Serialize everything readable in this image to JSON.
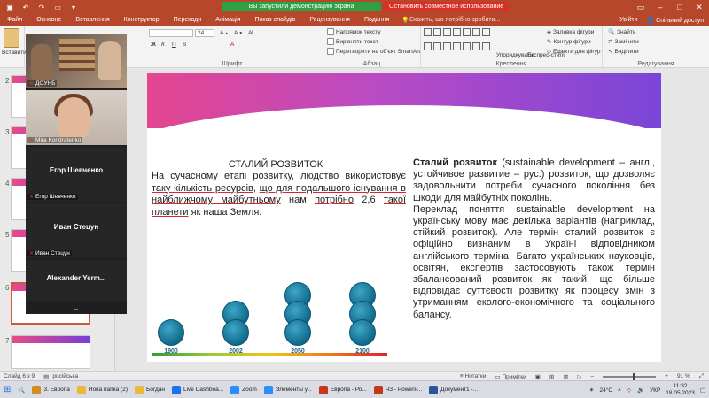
{
  "window": {
    "share_running": "Вы запустили демонстрацию экрана",
    "share_stop": "Остановить совместное использование"
  },
  "menu": {
    "tabs": [
      "Файл",
      "Основне",
      "Вставлення",
      "Конструктор",
      "Переходи",
      "Анімація",
      "Показ слайдів",
      "Рецензування",
      "Подання"
    ],
    "tell_me": "Скажіть, що потрібно зробити...",
    "sign_in": "Увійти",
    "share": "Спільний доступ"
  },
  "ribbon": {
    "insert_label": "Вставити",
    "font_size": "24",
    "text_direction": "Напрямок тексту",
    "align_text": "Вирівняти текст",
    "convert_smartart": "Перетворити на об'єкт SmartArt",
    "arrange": "Упорядкувати",
    "quick_styles": "Експрес-стилі",
    "shape_fill": "Заливка фігури",
    "shape_outline": "Контур фігури",
    "shape_effects": "Ефекти для фігур",
    "find": "Знайти",
    "replace": "Замінити",
    "select": "Виділити",
    "group_font": "Шрифт",
    "group_paragraph": "Абзац",
    "group_drawing": "Креслення",
    "group_editing": "Редагування"
  },
  "thumbnails": {
    "numbers": [
      "2",
      "3",
      "4",
      "5",
      "6",
      "7"
    ]
  },
  "zoom": {
    "participants": [
      {
        "name": "ДОУНБ",
        "type": "video1"
      },
      {
        "name": "Mira Kondratenko",
        "type": "video2"
      },
      {
        "name": "Егор Шевченко",
        "label": "Егор Шевченко",
        "type": "name"
      },
      {
        "name": "Иван Стецун",
        "label": "Иван Стецун",
        "type": "name"
      },
      {
        "name": "Alexander Yerm...",
        "type": "name"
      }
    ]
  },
  "slide": {
    "left_title": "СТАЛИЙ РОЗВИТОК",
    "left_text_parts": [
      {
        "t": "На ",
        "u": false
      },
      {
        "t": "сучасному етапі розвитку",
        "u": true
      },
      {
        "t": ", ",
        "u": false
      },
      {
        "t": "людство використовує таку кількість ресурсів",
        "u": true
      },
      {
        "t": ", ",
        "u": false
      },
      {
        "t": "що для подальшого існування в найближчому майбутньому",
        "u": true
      },
      {
        "t": " нам ",
        "u": false
      },
      {
        "t": "потрібно",
        "u": true
      },
      {
        "t": " 2,6 ",
        "u": false
      },
      {
        "t": "такої планети",
        "u": true
      },
      {
        "t": " як наша Земля.",
        "u": false
      }
    ],
    "right_bold": "Сталий розвиток",
    "right_p1_rest": " (sustainable development – англ., устойчивое развитие – рус.) розвиток, що дозволяє задовольнити потреби сучасного покоління без шкоди для майбутніх поколінь.",
    "right_p2": "Переклад поняття sustainable development на українську мову має декілька варіантів (наприклад, стійкий розвиток). Але термін сталий розвиток є офіційно визнаним в Україні відповідником англійського терміна. Багато українських науковців, освітян, експертів застосовують також термін збалансований розвиток як такий, що більше відповідає суттєвості розвитку як процесу змін з утриманням еколого-економічного та соціального балансу.",
    "globe_years": [
      {
        "year": "1900",
        "count": 1
      },
      {
        "year": "2002",
        "count": 2
      },
      {
        "year": "2050",
        "count": 3
      },
      {
        "year": "2100",
        "count": 3
      }
    ]
  },
  "status": {
    "slide_of": "Слайд 6 з 9",
    "language": "російська",
    "notes": "Нотатки",
    "comments": "Примітки",
    "zoom_pct": "91 %"
  },
  "taskbar": {
    "items": [
      {
        "label": "3. Европа",
        "color": "#d28b26"
      },
      {
        "label": "Нова папка (2)",
        "color": "#e8b93a"
      },
      {
        "label": "Богдан",
        "color": "#e8b93a"
      },
      {
        "label": "Live Dashboa...",
        "color": "#1a73e8"
      },
      {
        "label": "Zoom",
        "color": "#2d8cff"
      },
      {
        "label": "Элементы у...",
        "color": "#2d8cff"
      },
      {
        "label": "Европа - Ро...",
        "color": "#c4391d"
      },
      {
        "label": "ЧЗ - PowerP...",
        "color": "#c4391d"
      },
      {
        "label": "Документ1 -...",
        "color": "#2b579a"
      }
    ],
    "temperature": "24°C",
    "lang": "УКР",
    "time": "11:32",
    "date": "18.05.2023"
  }
}
